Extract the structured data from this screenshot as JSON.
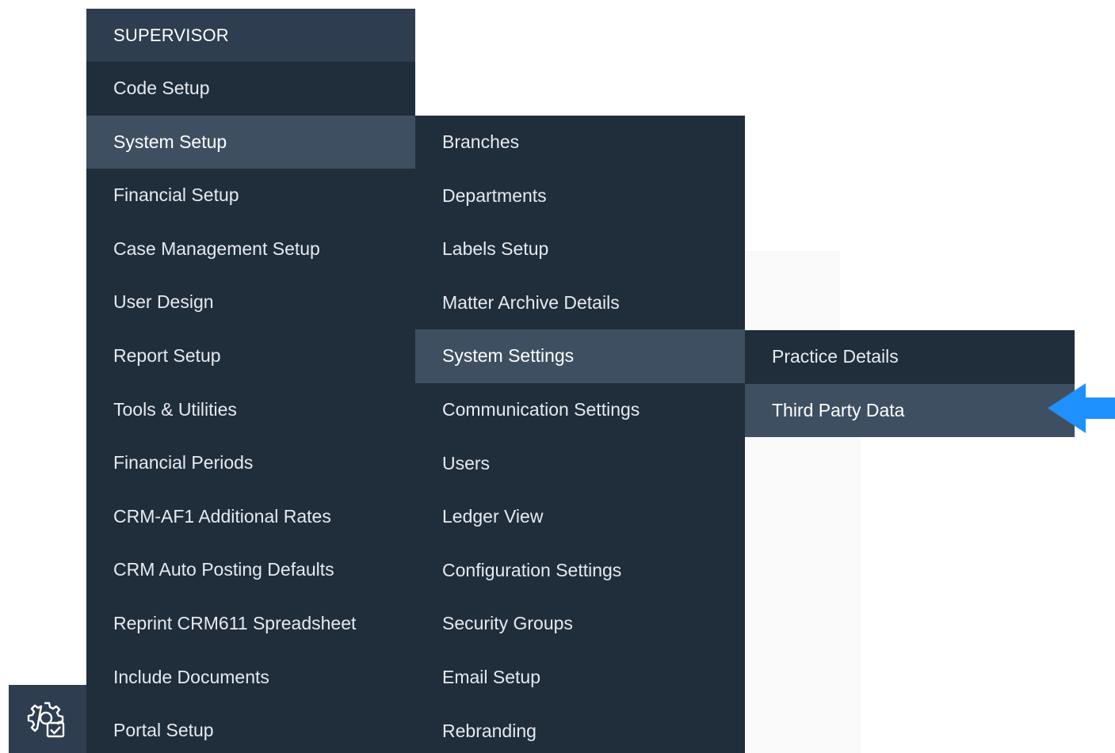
{
  "supervisor_menu": {
    "header": "SUPERVISOR",
    "items": [
      {
        "label": "Code Setup"
      },
      {
        "label": "System Setup",
        "active": true
      },
      {
        "label": "Financial Setup"
      },
      {
        "label": "Case Management Setup"
      },
      {
        "label": "User Design"
      },
      {
        "label": "Report Setup"
      },
      {
        "label": "Tools & Utilities"
      },
      {
        "label": "Financial Periods"
      },
      {
        "label": "CRM-AF1 Additional Rates"
      },
      {
        "label": "CRM Auto Posting Defaults"
      },
      {
        "label": "Reprint CRM611 Spreadsheet"
      },
      {
        "label": "Include Documents"
      },
      {
        "label": "Portal Setup"
      }
    ]
  },
  "system_setup_menu": {
    "items": [
      {
        "label": "Branches"
      },
      {
        "label": "Departments"
      },
      {
        "label": "Labels Setup"
      },
      {
        "label": "Matter Archive Details"
      },
      {
        "label": "System Settings",
        "active": true
      },
      {
        "label": "Communication Settings"
      },
      {
        "label": "Users"
      },
      {
        "label": "Ledger View"
      },
      {
        "label": "Configuration Settings"
      },
      {
        "label": "Security Groups"
      },
      {
        "label": "Email Setup"
      },
      {
        "label": "Rebranding"
      }
    ]
  },
  "system_settings_menu": {
    "items": [
      {
        "label": "Practice Details"
      },
      {
        "label": "Third Party Data",
        "active": true
      }
    ]
  },
  "sidebar": {
    "icon": "settings-gear-icon"
  },
  "colors": {
    "menu_bg": "#202d3b",
    "header_bg": "#2e3d4f",
    "active_bg": "#3f4f62",
    "arrow": "#1e90ff"
  }
}
